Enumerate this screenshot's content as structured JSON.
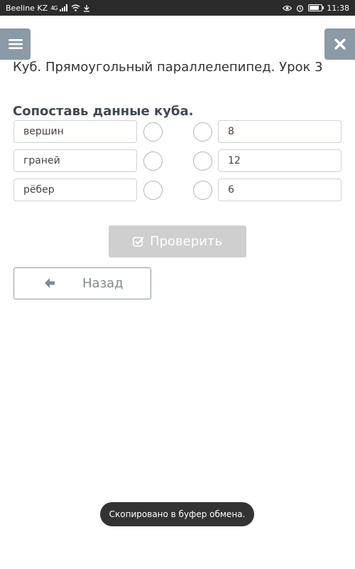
{
  "status_bar": {
    "carrier": "Beeline KZ",
    "network": "4G",
    "time": "11:38",
    "battery_level": 0.8
  },
  "header": {
    "lesson_title": "Куб. Прямоугольный параллелепипед. Урок 3",
    "menu_icon": "hamburger-icon",
    "close_icon": "close-icon"
  },
  "task": {
    "title": "Сопоставь данные куба.",
    "left_items": [
      {
        "label": "вершин"
      },
      {
        "label": "граней"
      },
      {
        "label": "рёбер"
      }
    ],
    "right_items": [
      {
        "label": "8"
      },
      {
        "label": "12"
      },
      {
        "label": "6"
      }
    ]
  },
  "actions": {
    "check_label": "Проверить",
    "check_icon": "checkbox-icon",
    "back_label": "Назад",
    "back_icon": "arrow-left-icon"
  },
  "toast": {
    "message": "Скопировано в буфер обмена."
  },
  "colors": {
    "side_button": "#8a9aa6",
    "check_disabled": "#cfcfcf",
    "toast_bg": "#333333"
  }
}
